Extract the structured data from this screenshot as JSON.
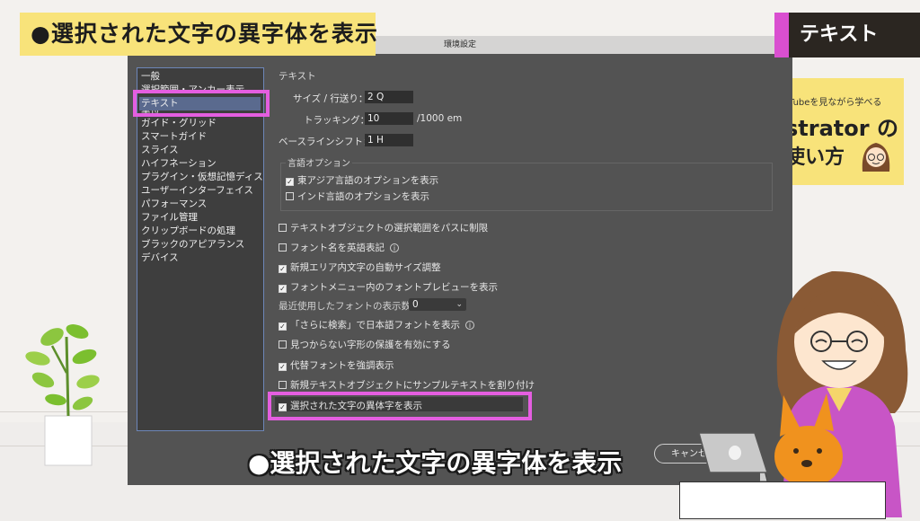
{
  "banner": {
    "title": "●選択された文字の異字体を表示",
    "category": "テキスト"
  },
  "course_card": {
    "line1": "Tubeを見ながら学べる",
    "line2": "strator の",
    "line3": "使い方"
  },
  "dialog": {
    "window_title": "環境設定",
    "sidebar": {
      "items": [
        "一般",
        "選択範囲・アンカー表示",
        "テキスト",
        "単位",
        "ガイド・グリッド",
        "スマートガイド",
        "スライス",
        "ハイフネーション",
        "プラグイン・仮想記憶ディスク",
        "ユーザーインターフェイス",
        "パフォーマンス",
        "ファイル管理",
        "クリップボードの処理",
        "ブラックのアピアランス",
        "デバイス"
      ],
      "selected": "テキスト"
    },
    "panel": {
      "heading": "テキスト",
      "size_label": "サイズ / 行送り：",
      "size_value": "2 Q",
      "tracking_label": "トラッキング：",
      "tracking_value": "10",
      "tracking_unit": "/1000 em",
      "baseline_label": "ベースラインシフト：",
      "baseline_value": "1 H",
      "language_group": {
        "title": "言語オプション",
        "east_asian": {
          "label": "東アジア言語のオプションを表示",
          "checked": true
        },
        "indic": {
          "label": "インド言語のオプションを表示",
          "checked": false
        }
      },
      "options": [
        {
          "label": "テキストオブジェクトの選択範囲をパスに制限",
          "checked": false
        },
        {
          "label": "フォント名を英語表記",
          "checked": false,
          "info": true
        },
        {
          "label": "新規エリア内文字の自動サイズ調整",
          "checked": true
        },
        {
          "label": "フォントメニュー内のフォントプレビューを表示",
          "checked": true
        }
      ],
      "recent_fonts_label": "最近使用したフォントの表示数：",
      "recent_fonts_value": "0",
      "options2": [
        {
          "label": "「さらに検索」で日本語フォントを表示",
          "checked": true,
          "info": true
        },
        {
          "label": "見つからない字形の保護を有効にする",
          "checked": false
        },
        {
          "label": "代替フォントを強調表示",
          "checked": true
        },
        {
          "label": "新規テキストオブジェクトにサンプルテキストを割り付け",
          "checked": false
        }
      ],
      "highlight_option": {
        "label": "選択された文字の異体字を表示",
        "checked": true
      }
    },
    "cancel_label": "キャンセル"
  },
  "caption": "●選択された文字の異字体を表示",
  "colors": {
    "highlight": "#e45ee0",
    "banner_yellow": "#f8e37a",
    "dialog_bg": "#535353"
  }
}
